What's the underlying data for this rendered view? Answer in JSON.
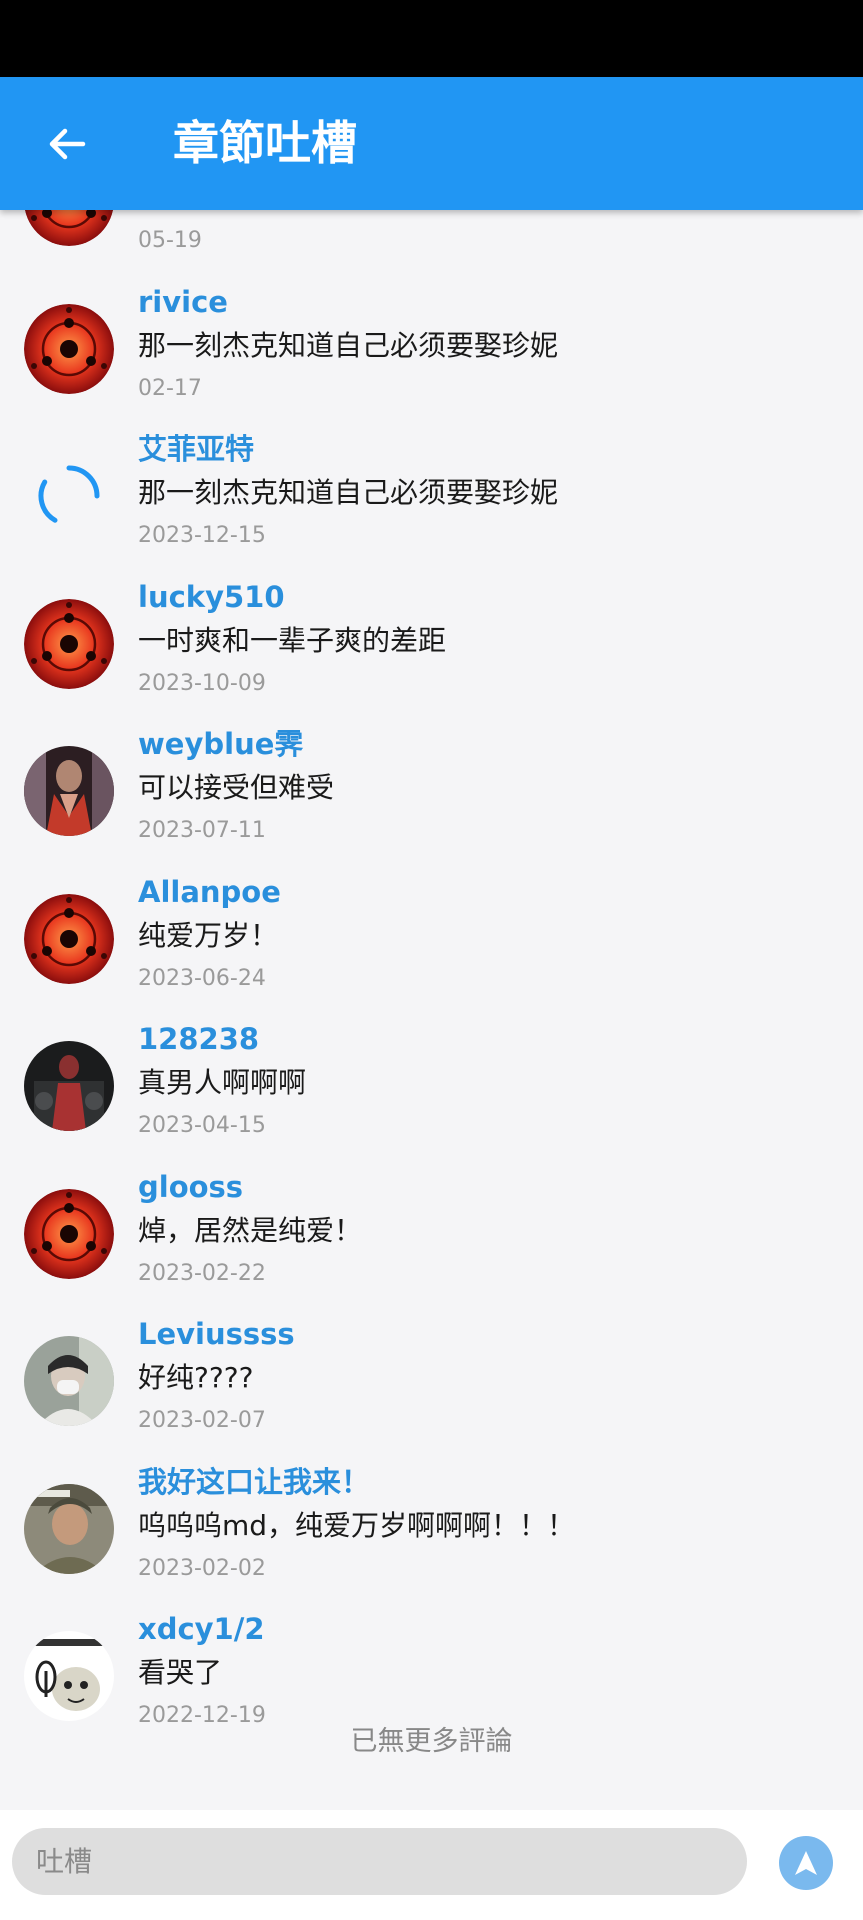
{
  "app_bar": {
    "title": "章節吐槽",
    "back_icon": "arrow-left-icon",
    "background": "#2196f3"
  },
  "comments": [
    {
      "name": "",
      "text": "",
      "date": "05-19",
      "avatar": "sharingan"
    },
    {
      "name": "rivice",
      "text": "那一刻杰克知道自己必须要娶珍妮",
      "date": "02-17",
      "avatar": "sharingan"
    },
    {
      "name": "艾菲亚特",
      "text": "那一刻杰克知道自己必须要娶珍妮",
      "date": "2023-12-15",
      "avatar": "loading"
    },
    {
      "name": "lucky510",
      "text": "一时爽和一辈子爽的差距",
      "date": "2023-10-09",
      "avatar": "sharingan"
    },
    {
      "name": "weyblue霁",
      "text": "可以接受但难受",
      "date": "2023-07-11",
      "avatar": "photo-red"
    },
    {
      "name": "Allanpoe",
      "text": "纯爱万岁！",
      "date": "2023-06-24",
      "avatar": "sharingan"
    },
    {
      "name": "128238",
      "text": "真男人啊啊啊",
      "date": "2023-04-15",
      "avatar": "photo-dark"
    },
    {
      "name": "glooss",
      "text": "焯，居然是纯爱！",
      "date": "2023-02-22",
      "avatar": "sharingan"
    },
    {
      "name": "Leviussss",
      "text": "好纯????",
      "date": "2023-02-07",
      "avatar": "photo-person"
    },
    {
      "name": "我好这口让我来！",
      "text": "呜呜呜md，纯爱万岁啊啊啊！！！",
      "date": "2023-02-02",
      "avatar": "photo-soldier"
    },
    {
      "name": "xdcy1/2",
      "text": "看哭了",
      "date": "2022-12-19",
      "avatar": "meme"
    }
  ],
  "footer_text": "已無更多評論",
  "input": {
    "placeholder": "吐槽",
    "value": ""
  },
  "send_button": {
    "icon": "send-arrow-icon",
    "color": "#7ab9ee"
  }
}
